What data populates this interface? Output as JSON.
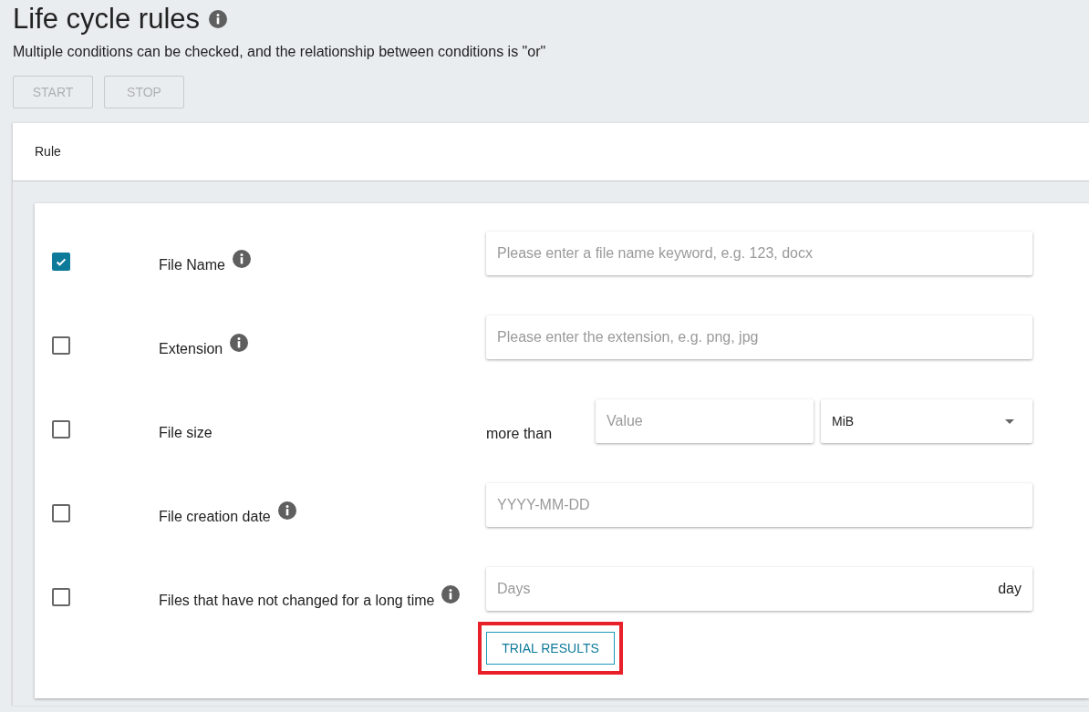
{
  "page": {
    "title": "Life cycle rules",
    "subtitle": "Multiple conditions can be checked, and the relationship between conditions is \"or\""
  },
  "buttons": [
    {
      "label": "START",
      "disabled": true
    },
    {
      "label": "STOP",
      "disabled": true
    }
  ],
  "card": {
    "header": "Rule"
  },
  "rules": [
    {
      "kind": "text",
      "label": "File Name",
      "info": true,
      "checked": true,
      "placeholder": "Please enter a file name keyword, e.g. 123, docx"
    },
    {
      "kind": "text",
      "label": "Extension",
      "info": true,
      "checked": false,
      "placeholder": "Please enter the extension, e.g. png, jpg"
    },
    {
      "kind": "size",
      "label": "File size",
      "info": false,
      "checked": false,
      "prefix": "more than",
      "placeholder": "Value",
      "unit": "MiB"
    },
    {
      "kind": "text",
      "label": "File creation date",
      "info": true,
      "checked": false,
      "placeholder": "YYYY-MM-DD"
    },
    {
      "kind": "suffix",
      "label": "Files that have not changed for a long time",
      "info": true,
      "checked": false,
      "placeholder": "Days",
      "suffix": "day"
    }
  ],
  "trial_button": {
    "label": "TRIAL RESULTS",
    "highlighted": true
  }
}
